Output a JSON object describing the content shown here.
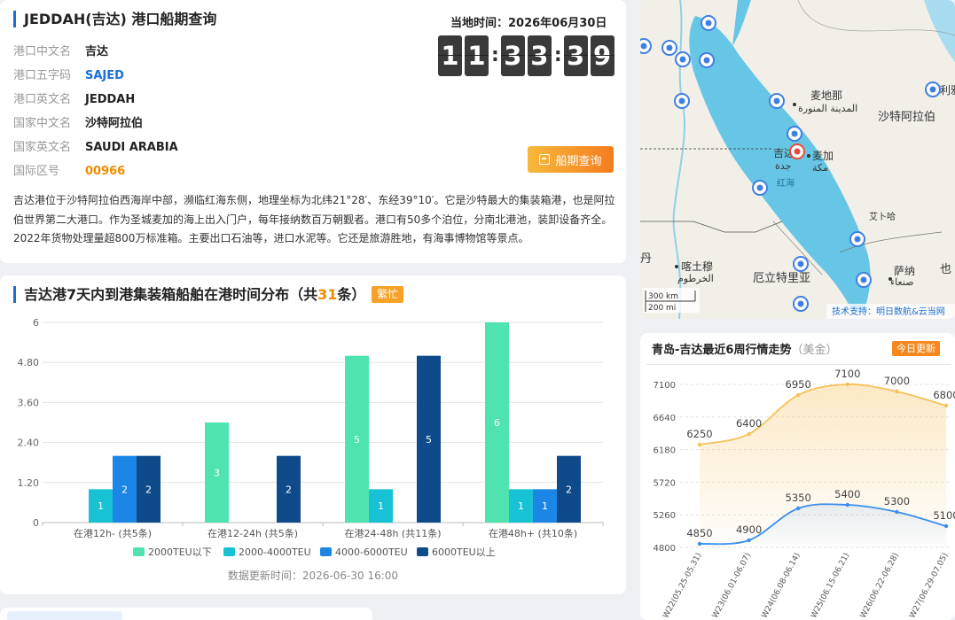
{
  "port": {
    "title": "JEDDAH(吉达) 港口船期查询",
    "fields": [
      {
        "label": "港口中文名",
        "value": "吉达",
        "style": "plain"
      },
      {
        "label": "港口五字码",
        "value": "SAJED",
        "style": "blue"
      },
      {
        "label": "港口英文名",
        "value": "JEDDAH",
        "style": "plain"
      },
      {
        "label": "国家中文名",
        "value": "沙特阿拉伯",
        "style": "plain"
      },
      {
        "label": "国家英文名",
        "value": "SAUDI ARABIA",
        "style": "plain"
      },
      {
        "label": "国际区号",
        "value": "00966",
        "style": "orange"
      }
    ],
    "local_time_label": "当地时间：2026年06月30日",
    "clock": [
      "1",
      "1",
      "3",
      "3",
      "3",
      "9"
    ],
    "schedule_button": "船期查询",
    "description": "吉达港位于沙特阿拉伯西海岸中部，濒临红海东侧，地理坐标为北纬21°28′、东经39°10′。它是沙特最大的集装箱港，也是阿拉伯世界第二大港口。作为圣城麦加的海上出入门户，每年接纳数百万朝觐者。港口有50多个泊位，分南北港池，装卸设备齐全。2022年货物处理量超800万标准箱。主要出口石油等，进口水泥等。它还是旅游胜地，有海事博物馆等景点。"
  },
  "distribution": {
    "title_prefix": "吉达港7天内到港集装箱船舶在港时间分布（共",
    "total": "31",
    "title_suffix": "条）",
    "badge": "繁忙",
    "updated": "数据更新时间：2026-06-30 16:00"
  },
  "chart_data": [
    {
      "type": "bar",
      "categories": [
        "在港12h- (共5条)",
        "在港12-24h (共5条)",
        "在港24-48h (共11条)",
        "在港48h+ (共10条)"
      ],
      "series": [
        {
          "name": "2000TEU以下",
          "color": "#4fe3b0",
          "values": [
            0,
            3,
            5,
            6
          ]
        },
        {
          "name": "2000-4000TEU",
          "color": "#17c2d4",
          "values": [
            1,
            0,
            1,
            1
          ]
        },
        {
          "name": "4000-6000TEU",
          "color": "#1c86e6",
          "values": [
            2,
            0,
            0,
            1
          ]
        },
        {
          "name": "6000TEU以上",
          "color": "#0f4a8a",
          "values": [
            2,
            2,
            5,
            2
          ]
        }
      ],
      "yticks": [
        "0",
        "1.20",
        "2.40",
        "3.60",
        "4.80",
        "6"
      ],
      "ylim": [
        0,
        6
      ],
      "grid": true,
      "legend": "bottom"
    },
    {
      "type": "line",
      "categories": [
        "W22(05.25-05.31)",
        "W23(06.01-06.07)",
        "W24(06.08-06.14)",
        "W25(06.15-06.21)",
        "W26(06.22-06.28)",
        "W27(06.29-07.05)"
      ],
      "series": [
        {
          "color": "#f5c15a",
          "values": [
            6250,
            6400,
            6950,
            7100,
            7000,
            6800
          ]
        },
        {
          "color": "#3a8ff0",
          "values": [
            4850,
            4900,
            5350,
            5400,
            5300,
            5100
          ]
        }
      ],
      "yticks": [
        "4800",
        "5260",
        "5720",
        "6180",
        "6640",
        "7100"
      ],
      "ylim": [
        4800,
        7100
      ],
      "grid": true
    }
  ],
  "map": {
    "labels": {
      "medina": "麦地那",
      "medina_ar": "المدينة المنورة",
      "saudi": "沙特阿拉伯",
      "jeddah": "吉达",
      "jeddah_ar": "جدة",
      "mecca": "麦加",
      "mecca_ar": "مكة",
      "red_sea": "红海",
      "khartoum": "喀土穆",
      "khartoum_ar": "الخرطوم",
      "eritrea": "厄立特里亚",
      "sanaa": "萨纳",
      "sanaa_ar": "صنعاء",
      "asir": "艾卜哈",
      "dan": "丹",
      "ye": "也",
      "riyadh": "利雅",
      "scale_km": "300 km",
      "scale_mi": "200 mi",
      "credit": "技术支持：明日数航&云当网"
    }
  },
  "trend": {
    "title": "青岛-吉达最近6周行情走势",
    "unit": "（美金）",
    "badge": "今日更新"
  }
}
